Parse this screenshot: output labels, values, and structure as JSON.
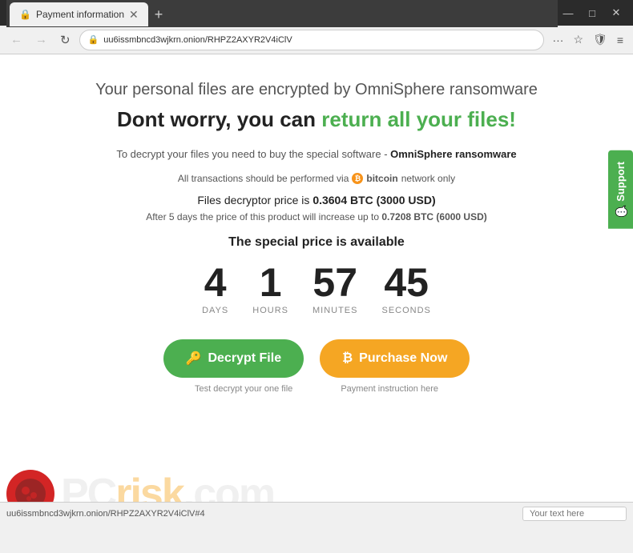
{
  "window": {
    "title": "Payment information",
    "tab_close": "✕",
    "new_tab": "+",
    "controls": {
      "minimize": "—",
      "maximize": "□",
      "close": "✕"
    }
  },
  "nav": {
    "back": "←",
    "forward": "→",
    "refresh": "↻",
    "url": "uu6issmbncd3wjkrn.onion/RHPZ2AXYR2V4iClV",
    "more": "···",
    "star": "☆",
    "shield": "🛡",
    "menu": "≡"
  },
  "page": {
    "headline1": "Your personal files are encrypted by OmniSphere ransomware",
    "headline2_prefix": "Dont worry, you can ",
    "headline2_highlight": "return all your files!",
    "decrypt_info_prefix": "To decrypt your files you need to buy the special software - ",
    "decrypt_info_software": "OmniSphere ransomware",
    "bitcoin_text": "All transactions should be performed via",
    "bitcoin_logo": "₿",
    "bitcoin_network": "network only",
    "bitcoin_name": "bitcoin",
    "price_prefix": "Files decryptor price is ",
    "price_amount": "0.3604 BTC (3000 USD)",
    "price_increase_text": "After 5 days the price of this product will increase up to ",
    "price_increase_amount": "0.7208 BTC (6000 USD)",
    "special_price_label": "The special price is available",
    "countdown": {
      "days_value": "4",
      "days_label": "DAYS",
      "hours_value": "1",
      "hours_label": "HOURS",
      "minutes_value": "57",
      "minutes_label": "MINUTES",
      "seconds_value": "45",
      "seconds_label": "SECONDS"
    },
    "decrypt_btn": "Decrypt File",
    "decrypt_icon": "🔑",
    "decrypt_caption": "Test decrypt your one file",
    "purchase_btn": "Purchase Now",
    "purchase_icon": "₿",
    "purchase_caption": "Payment instruction here",
    "support_tab": "Support",
    "support_icon": "💬"
  },
  "watermark": {
    "url": "uu6issmbncd3wjkrn.onion/RHPZ2AXYR2V4iClV#4",
    "logo_text": "PC",
    "brand_pc": "PC",
    "brand_risk": "risk",
    "brand_com": ".com"
  },
  "bottom": {
    "url_text": "uu6issmbncd3wjkrn.onion/RHPZ2AXYR2V4iClV#4",
    "input_placeholder": "Your text here"
  }
}
